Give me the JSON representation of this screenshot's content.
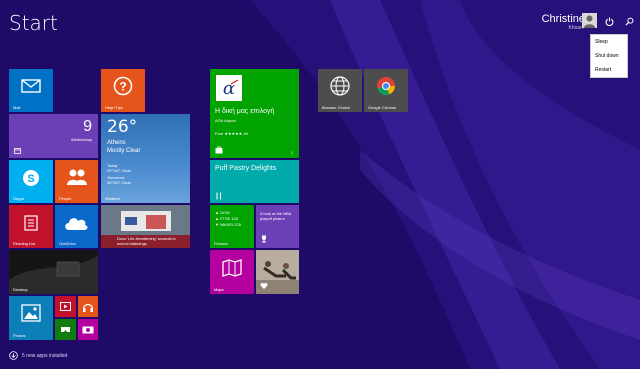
{
  "start": {
    "title": "Start"
  },
  "user": {
    "name": "Christine",
    "subtitle": "Khoan"
  },
  "power_menu": {
    "items": [
      "Sleep",
      "Shut down",
      "Restart"
    ]
  },
  "tiles": {
    "mail": "Mail",
    "help": "Help+Tips",
    "calendar_day": "9",
    "calendar_weekday": "Wednesday",
    "weather_temp": "26°",
    "weather_city": "Athens",
    "weather_cond": "Mostly Clear",
    "weather_today": "Today",
    "weather_today_range": "29°/18° Clear",
    "weather_tomorrow": "Tomorrow",
    "weather_tomorrow_range": "30°/20° Clear",
    "weather": "Weather",
    "skype": "Skype",
    "people": "People",
    "reading_list": "Reading List",
    "onedrive": "OneDrive",
    "news_headline": "Docs 'Life-threatening' wounds in school stabbings",
    "desktop": "Desktop",
    "photos": "Photos",
    "store_title": "Η δική μας επιλογή",
    "store_sub": "ΑΠΑ Airport",
    "store_rating": "Free ★★★★★ 46",
    "store_count": "1",
    "food_title": "Puff Pastry Delights",
    "finance_line1": "▲ DOW",
    "finance_line2": "▲ FTSE 100",
    "finance_line3": "▼ NIKKEI 225",
    "finance": "Finance",
    "sports_text": "A look at the NBA playoff picture",
    "maps": "Maps",
    "browser_choice": "Browser Choice",
    "chrome": "Google Chrome"
  },
  "footer": {
    "text": "5 new apps installed"
  },
  "colors": {
    "background": "#1f0a68",
    "mail": "#0072c6",
    "help": "#e5541b",
    "green": "#00a300",
    "teal": "#00aba9",
    "magenta": "#b4009e",
    "red": "#c1112b"
  }
}
